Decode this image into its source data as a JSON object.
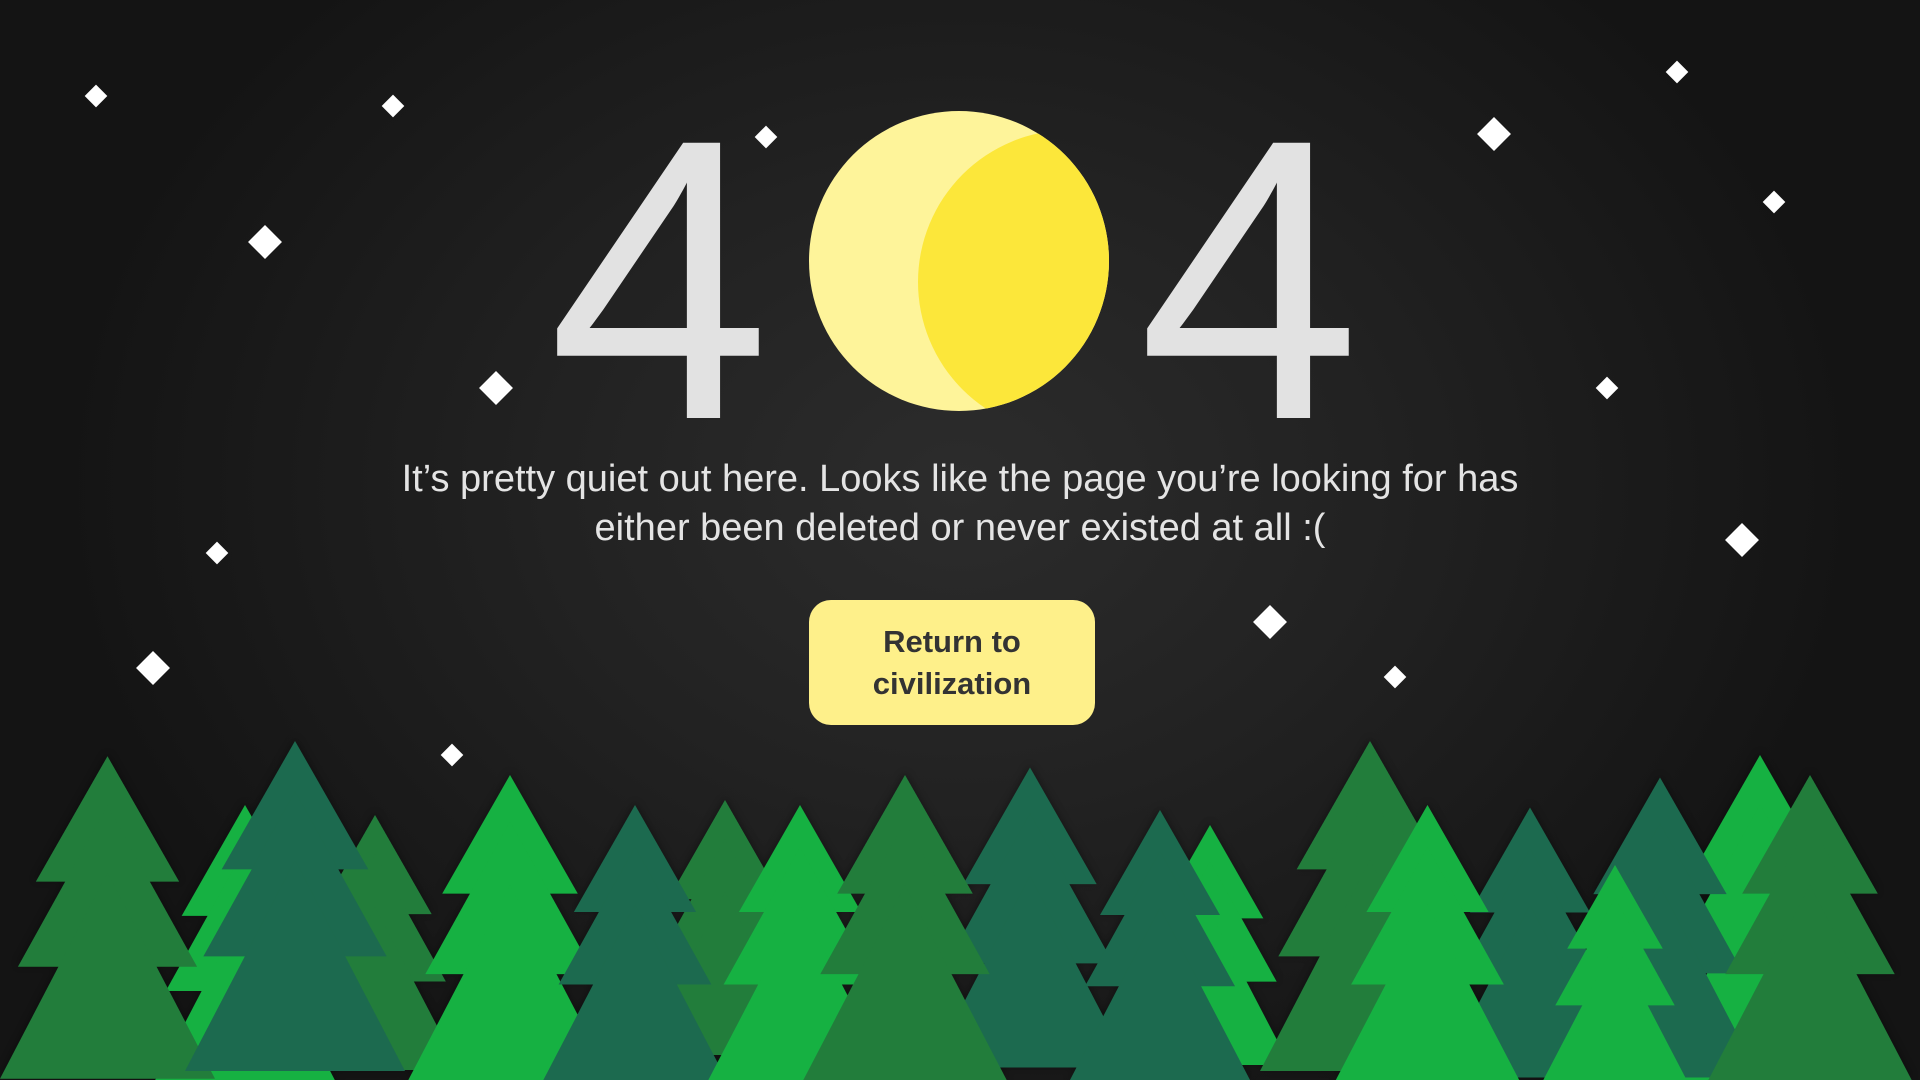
{
  "error": {
    "digit_left": "4",
    "digit_right": "4",
    "moon_icon": "crescent-moon-icon"
  },
  "message": {
    "text": "It’s pretty quiet out here. Looks like the page you’re looking for has either been deleted or never existed at all :("
  },
  "button": {
    "label": "Return to civilization"
  },
  "scene": {
    "star_icon": "diamond-star-icon",
    "tree_icon": "pine-tree-icon"
  },
  "colors": {
    "background": "#1f1f1f",
    "digits": "#e2e2e2",
    "moon_light": "#fef49a",
    "moon_dark": "#fce73a",
    "button": "#fef08a",
    "tree_dark_teal": "#1d6b4f",
    "tree_forest": "#217d3b",
    "tree_bright": "#16b142"
  }
}
